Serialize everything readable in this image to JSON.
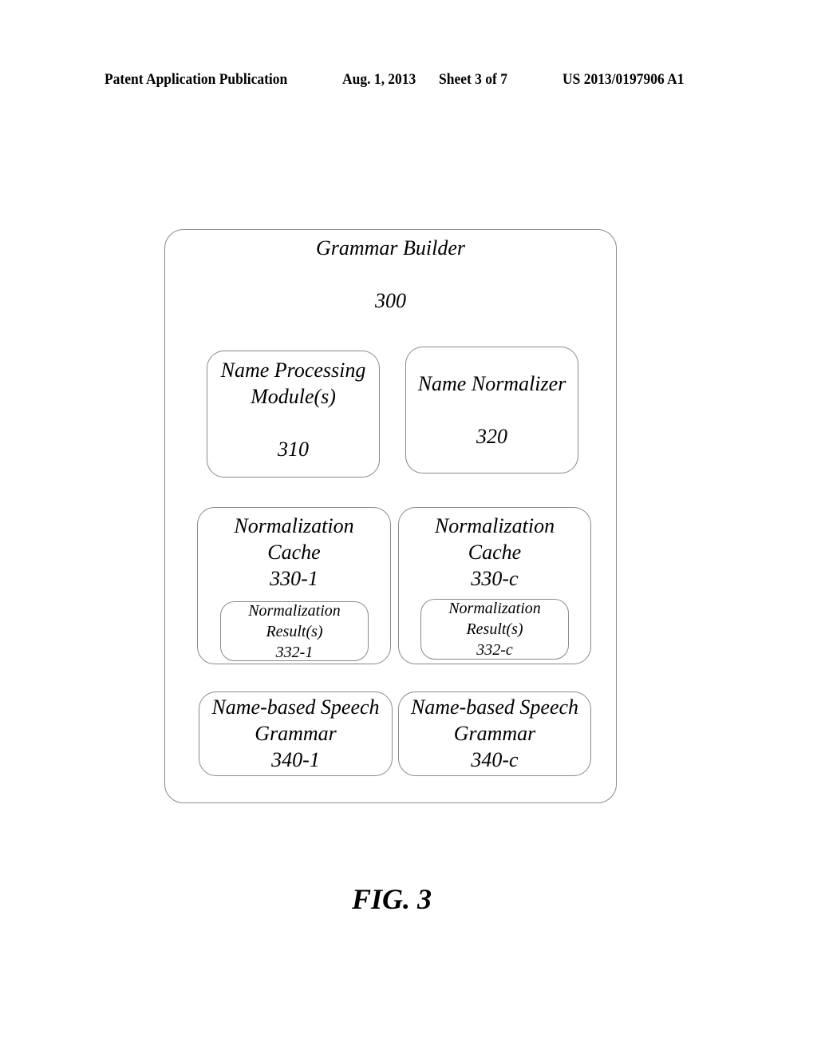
{
  "header": {
    "publication": "Patent Application Publication",
    "date": "Aug. 1, 2013",
    "sheet": "Sheet 3 of 7",
    "number": "US 2013/0197906 A1"
  },
  "diagram": {
    "outer": {
      "title": "Grammar Builder",
      "ref": "300"
    },
    "name_processing": {
      "line1": "Name Processing",
      "line2": "Module(s)",
      "ref": "310"
    },
    "name_normalizer": {
      "line1": "Name Normalizer",
      "ref": "320"
    },
    "cache_1": {
      "line1": "Normalization",
      "line2": "Cache",
      "ref": "330-1",
      "result": {
        "line1": "Normalization",
        "line2": "Result(s)",
        "ref": "332-1"
      }
    },
    "cache_c": {
      "line1": "Normalization",
      "line2": "Cache",
      "ref": "330-c",
      "result": {
        "line1": "Normalization",
        "line2": "Result(s)",
        "ref": "332-c"
      }
    },
    "grammar_1": {
      "line1": "Name-based Speech",
      "line2": "Grammar",
      "ref": "340-1"
    },
    "grammar_c": {
      "line1": "Name-based Speech",
      "line2": "Grammar",
      "ref": "340-c"
    }
  },
  "figure_label": "FIG. 3"
}
